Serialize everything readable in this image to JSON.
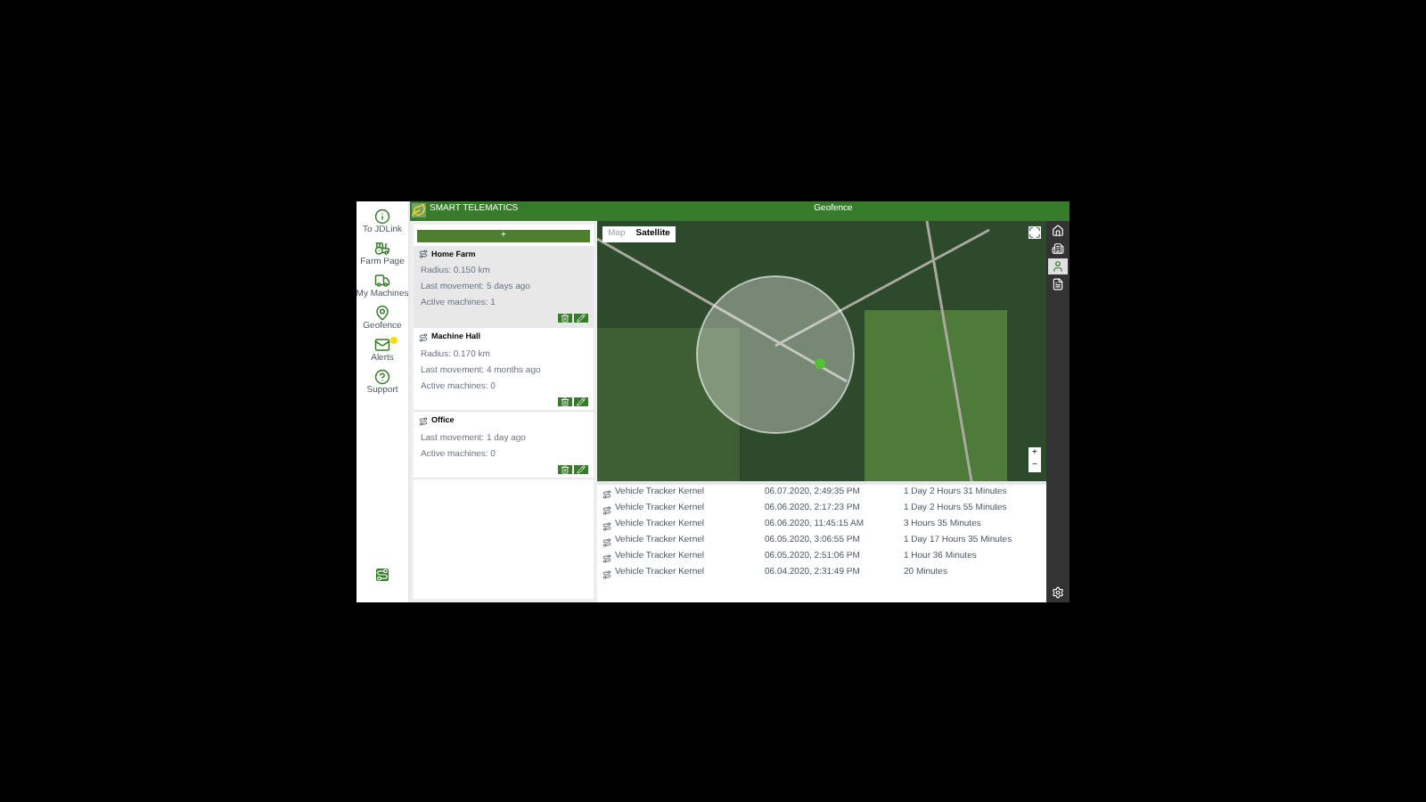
{
  "nav": [
    {
      "kind": "info",
      "label": "To JDLink"
    },
    {
      "kind": "farm",
      "label": "Farm Page"
    },
    {
      "kind": "machines",
      "label": "My Machines"
    },
    {
      "kind": "geofence",
      "label": "Geofence"
    },
    {
      "kind": "alerts",
      "label": "Alerts"
    },
    {
      "kind": "support",
      "label": "Support"
    }
  ],
  "logo": {
    "title": "SMART TELEMATICS"
  },
  "add_button": {
    "label": "+"
  },
  "geofences": [
    {
      "name": "Home Farm",
      "selected": true,
      "lines": [
        "Radius: 0.150 km",
        "Last movement: 5 days ago",
        "Active machines: 1"
      ]
    },
    {
      "name": "Machine Hall",
      "selected": false,
      "lines": [
        "Radius: 0.170 km",
        "Last movement: 4 months ago",
        "Active machines: 0"
      ]
    },
    {
      "name": "Office",
      "selected": false,
      "lines": [
        "Last movement: 1 day ago",
        "Active machines: 0"
      ]
    }
  ],
  "header": {
    "title": "Geofence"
  },
  "map": {
    "tabs": [
      {
        "label": "Map",
        "selected": false
      },
      {
        "label": "Satellite",
        "selected": true
      }
    ],
    "zoom_in": "+",
    "zoom_out": "−"
  },
  "table": {
    "rows": [
      {
        "machine": "Vehicle Tracker Kernel",
        "time": "06.07.2020, 2:49:35 PM",
        "duration": "1 Day 2 Hours 31 Minutes"
      },
      {
        "machine": "Vehicle Tracker Kernel",
        "time": "06.06.2020, 2:17:23 PM",
        "duration": "1 Day 2 Hours 55 Minutes"
      },
      {
        "machine": "Vehicle Tracker Kernel",
        "time": "06.06.2020, 11:45:15 AM",
        "duration": "3 Hours 35 Minutes"
      },
      {
        "machine": "Vehicle Tracker Kernel",
        "time": "06.05.2020, 3:06:55 PM",
        "duration": "1 Day 17 Hours 35 Minutes"
      },
      {
        "machine": "Vehicle Tracker Kernel",
        "time": "06.05.2020, 2:51:06 PM",
        "duration": "1 Hour 36 Minutes"
      },
      {
        "machine": "Vehicle Tracker Kernel",
        "time": "06.04.2020, 2:31:49 PM",
        "duration": "20 Minutes"
      }
    ]
  },
  "toolbar": [
    {
      "kind": "home",
      "selected": false
    },
    {
      "kind": "buildings",
      "selected": false
    },
    {
      "kind": "person",
      "selected": true
    },
    {
      "kind": "report",
      "selected": false
    }
  ]
}
